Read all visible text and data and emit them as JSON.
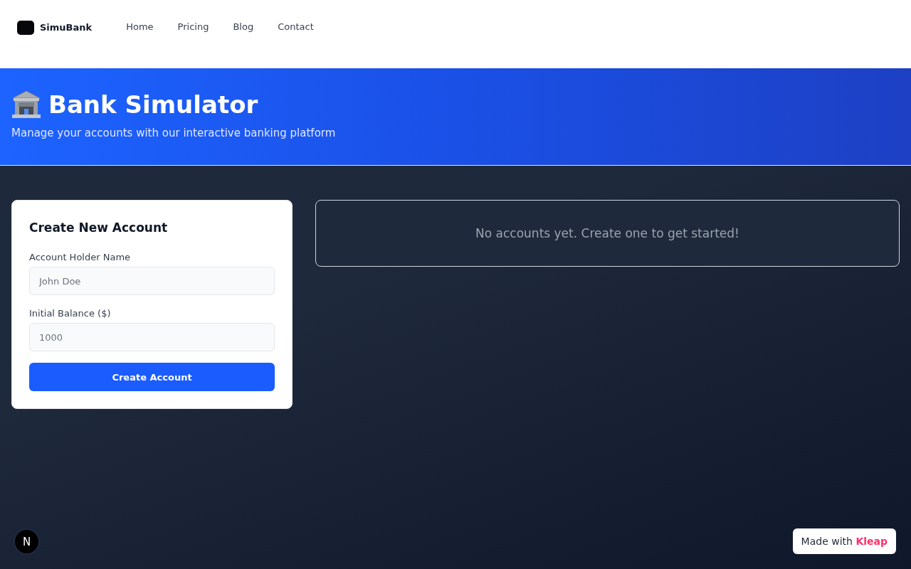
{
  "navbar": {
    "brand": "SimuBank",
    "links": [
      {
        "label": "Home"
      },
      {
        "label": "Pricing"
      },
      {
        "label": "Blog"
      },
      {
        "label": "Contact"
      }
    ]
  },
  "hero": {
    "title": "Bank Simulator",
    "subtitle": "Manage your accounts with our interactive banking platform"
  },
  "create_account_form": {
    "title": "Create New Account",
    "fields": [
      {
        "label": "Account Holder Name",
        "placeholder": "John Doe"
      },
      {
        "label": "Initial Balance ($)",
        "placeholder": "1000"
      }
    ],
    "submit_button": "Create Account"
  },
  "accounts_panel": {
    "empty_message": "No accounts yet. Create one to get started!"
  },
  "dev_indicator": {
    "label": "N"
  },
  "made_with_badge": {
    "text": "Made with **Kleap**"
  }
}
